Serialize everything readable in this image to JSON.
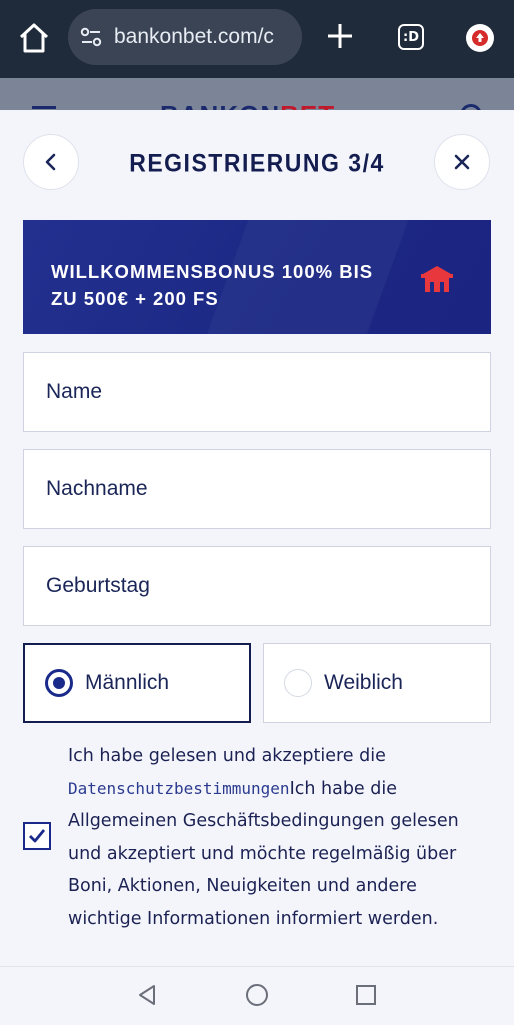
{
  "browser": {
    "url": "bankonbet.com/c",
    "tabs_label": ":D"
  },
  "site_header": {
    "logo_part1": "BANKON",
    "logo_part2": "BET"
  },
  "modal": {
    "title": "REGISTRIERUNG 3/4",
    "back_icon": "chevron-left-icon",
    "close_icon": "close-icon"
  },
  "bonus": {
    "text": "WILLKOMMENSBONUS 100% BIS\nZU 500€ + 200 FS",
    "icon_color": "#e8383d"
  },
  "form": {
    "name_placeholder": "Name",
    "lastname_placeholder": "Nachname",
    "birthday_placeholder": "Geburtstag",
    "gender_male": "Männlich",
    "gender_female": "Weiblich",
    "selected_gender": "male"
  },
  "consent": {
    "text_before": "Ich habe gelesen und akzeptiere die ",
    "link_text": "Datenschutzbestimmungen",
    "text_after": "Ich habe die Allgemeinen Geschäftsbedingungen gelesen und akzeptiert und möchte regelmäßig über Boni, Aktionen, Neuigkeiten und andere wichtige Informationen informiert werden.",
    "checked": true
  },
  "colors": {
    "primary": "#141d4f",
    "banner": "#1d2a86",
    "accent_red": "#e8383d"
  }
}
